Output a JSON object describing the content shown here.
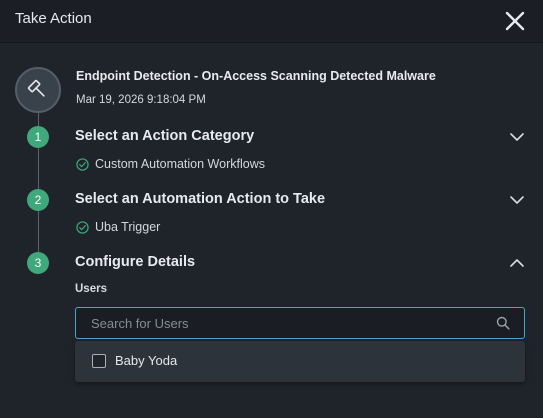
{
  "header": {
    "title": "Take Action"
  },
  "event": {
    "title": "Endpoint Detection - On-Access Scanning Detected Malware",
    "timestamp": "Mar 19, 2026 9:18:04 PM"
  },
  "steps": [
    {
      "number": "1",
      "title": "Select an Action Category",
      "selection": "Custom Automation Workflows",
      "expanded": false
    },
    {
      "number": "2",
      "title": "Select an Automation Action to Take",
      "selection": "Uba Trigger",
      "expanded": false
    },
    {
      "number": "3",
      "title": "Configure Details",
      "expanded": true
    }
  ],
  "config": {
    "users_label": "Users",
    "search_placeholder": "Search for Users",
    "search_value": "",
    "options": [
      {
        "label": "Baby Yoda",
        "checked": false
      }
    ]
  },
  "colors": {
    "step_accent": "#3fa97b",
    "focus_border": "#4aa3c8",
    "background": "#1f242b"
  },
  "icons": {
    "event": "gavel-icon",
    "close": "close-icon",
    "collapsed": "chevron-down-icon",
    "expanded": "chevron-up-icon",
    "completed": "check-circle-icon",
    "search": "search-icon"
  }
}
